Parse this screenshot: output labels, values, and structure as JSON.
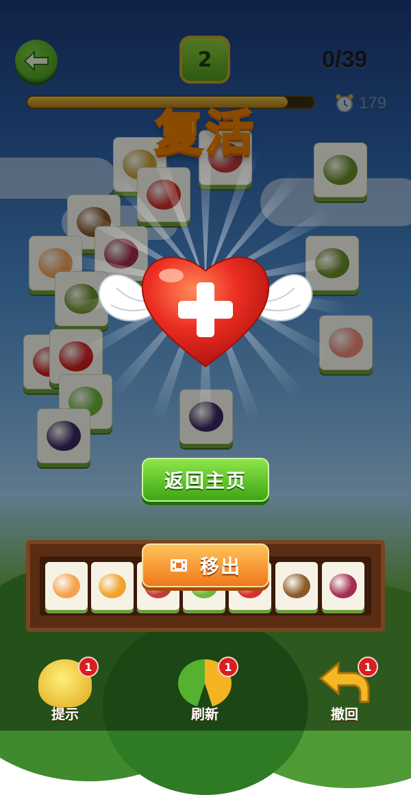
{
  "header": {
    "level": "2",
    "score": "0/39",
    "timer": "179",
    "progress_fraction": 0.91
  },
  "dialog": {
    "title": "复活",
    "home_button": "返回主页",
    "remove_button": "移出",
    "remove_icon": "video-ad-icon"
  },
  "board_tiles": [
    {
      "fruit": "durian",
      "color": "#c9a53a"
    },
    {
      "fruit": "lychee",
      "color": "#c23a3a"
    },
    {
      "fruit": "strawberry",
      "color": "#d4312e"
    },
    {
      "fruit": "kiwi",
      "color": "#6a8f2a"
    },
    {
      "fruit": "coconut",
      "color": "#8b5a2b"
    },
    {
      "fruit": "peach",
      "color": "#f1a35a"
    },
    {
      "fruit": "mangosteen",
      "color": "#a52d52"
    },
    {
      "fruit": "kiwi",
      "color": "#6a8f2a"
    },
    {
      "fruit": "kiwi",
      "color": "#6a8f2a"
    },
    {
      "fruit": "cherry",
      "color": "#d11e1e"
    },
    {
      "fruit": "cherry",
      "color": "#d11e1e"
    },
    {
      "fruit": "peach",
      "color": "#f08a7c"
    },
    {
      "fruit": "lime",
      "color": "#6cb83a"
    },
    {
      "fruit": "plum",
      "color": "#3a2a63"
    },
    {
      "fruit": "plum",
      "color": "#3a2a63"
    }
  ],
  "tray_slots": [
    {
      "fruit": "apricot",
      "color": "#f5a24a"
    },
    {
      "fruit": "orange",
      "color": "#f0a22a"
    },
    {
      "fruit": "lychee",
      "color": "#c23a3a"
    },
    {
      "fruit": "lime",
      "color": "#6cb83a"
    },
    {
      "fruit": "strawberry",
      "color": "#d4312e"
    },
    {
      "fruit": "coconut",
      "color": "#8b5a2b"
    },
    {
      "fruit": "mangosteen",
      "color": "#a52d52"
    }
  ],
  "bottom_bar": [
    {
      "label": "提示",
      "badge": "1",
      "icon": "lightbulb-icon"
    },
    {
      "label": "刷新",
      "badge": "1",
      "icon": "refresh-icon"
    },
    {
      "label": "撤回",
      "badge": "1",
      "icon": "undo-arrow-icon"
    }
  ],
  "colors": {
    "green_button": "#3ea614",
    "orange_button": "#f0781b",
    "title_yellow": "#ffe14d",
    "heart_red": "#e8281f"
  }
}
